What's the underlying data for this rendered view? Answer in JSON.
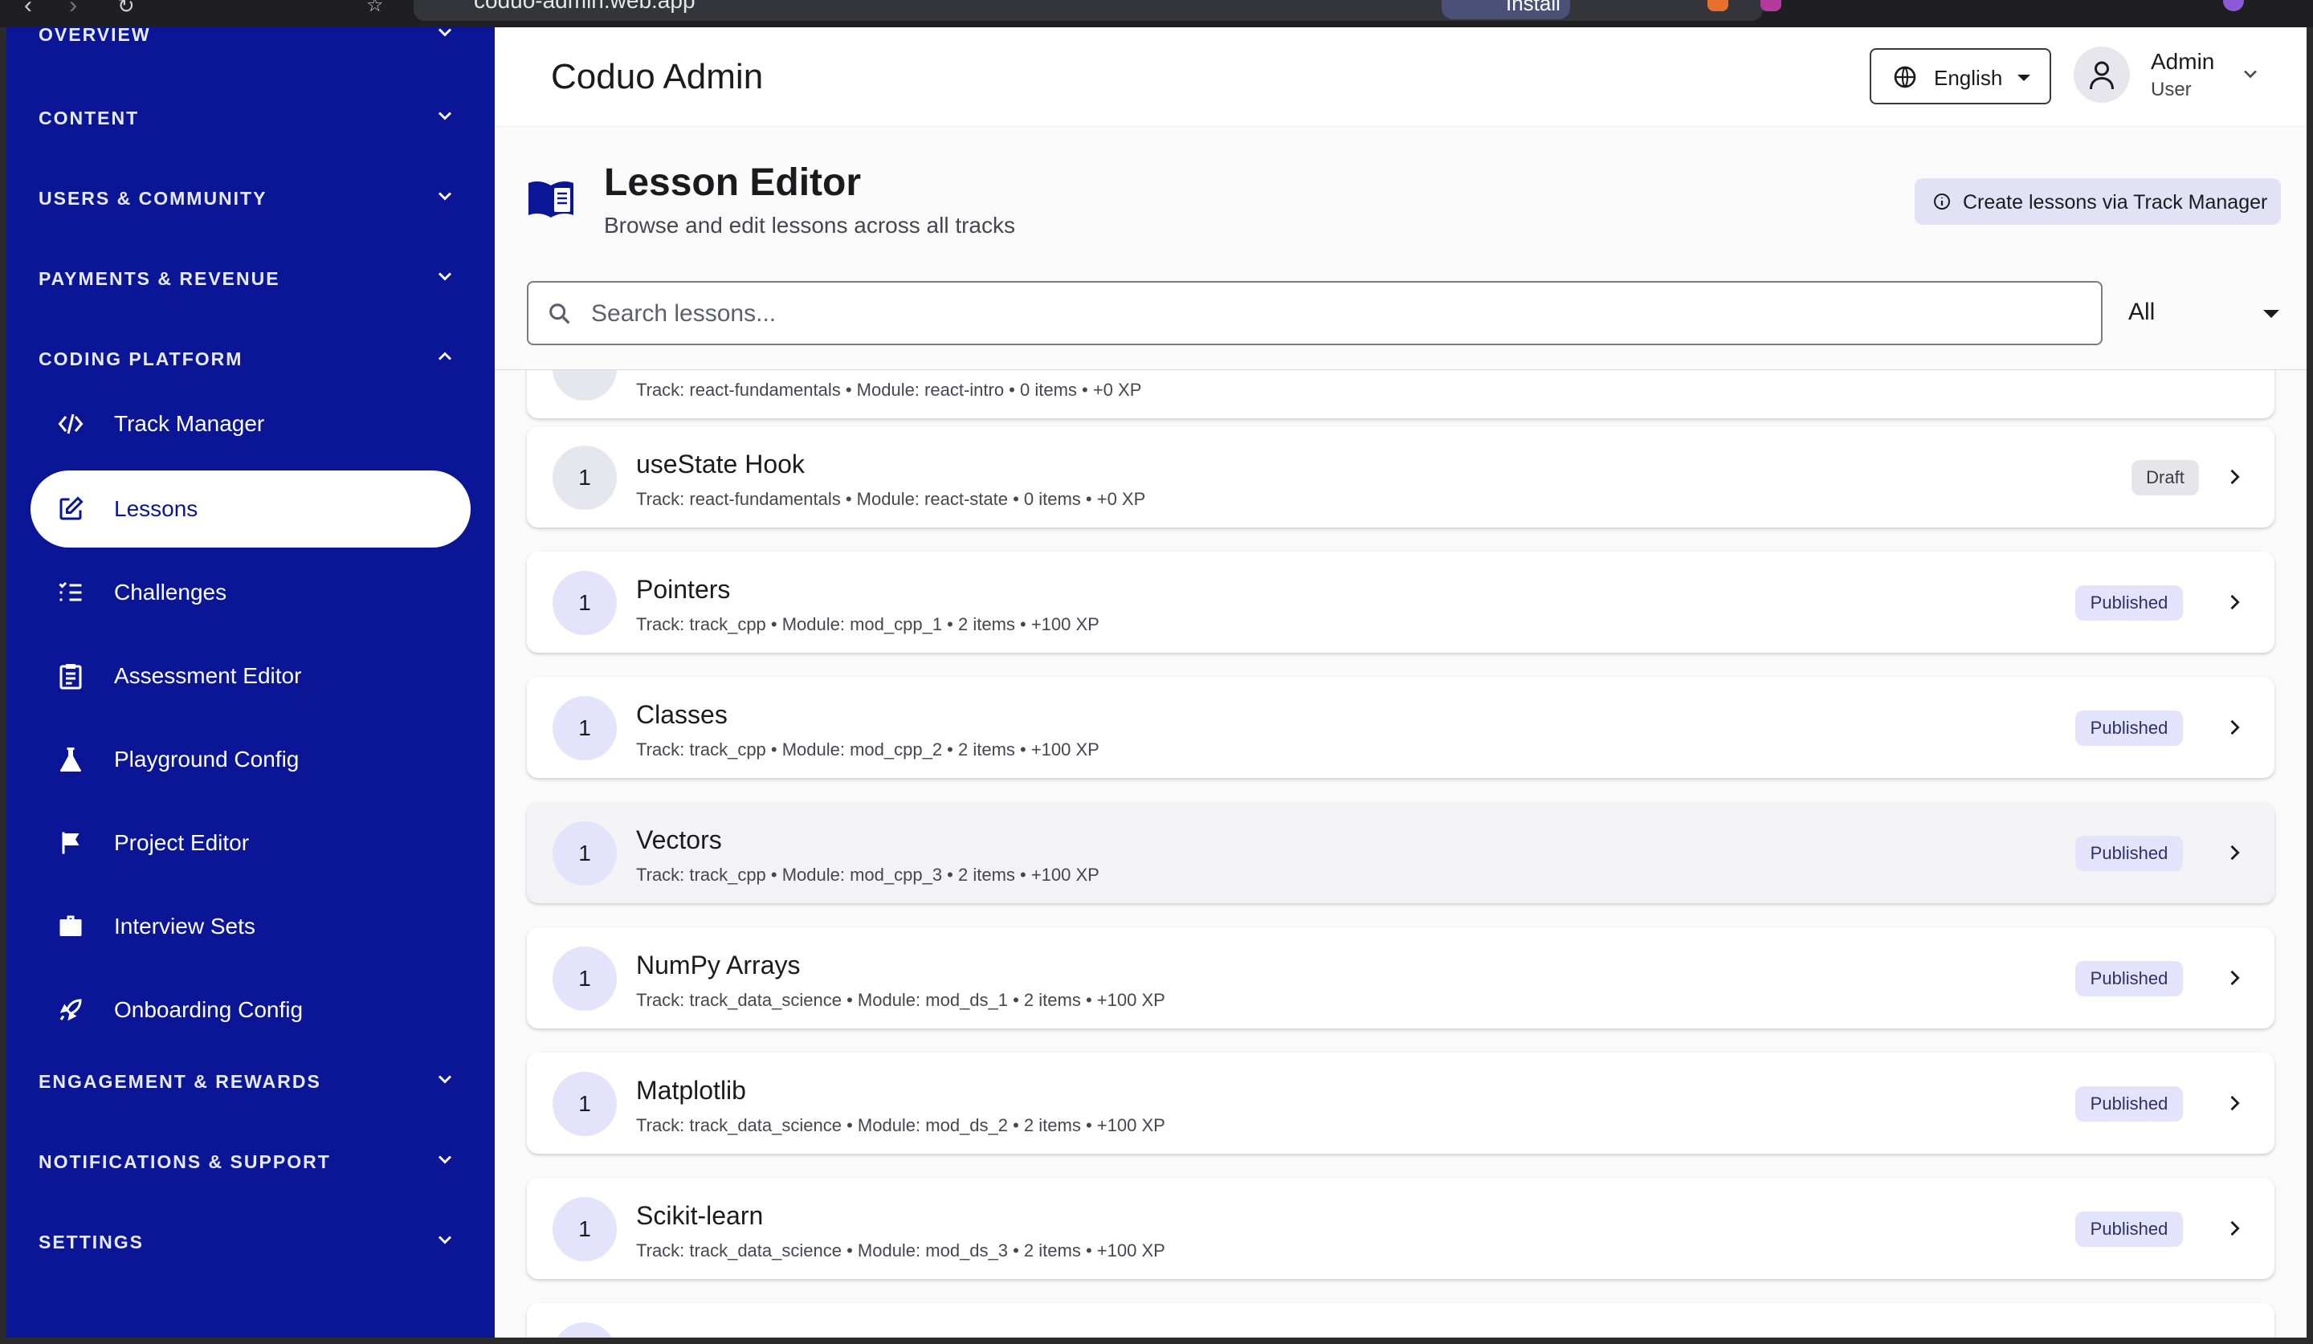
{
  "browser": {
    "url": "coduo-admin.web.app",
    "install_label": "Install"
  },
  "sidebar": {
    "top_section": "OVERVIEW",
    "sections": [
      {
        "label": "CONTENT"
      },
      {
        "label": "USERS & COMMUNITY"
      },
      {
        "label": "PAYMENTS & REVENUE"
      },
      {
        "label": "CODING PLATFORM"
      }
    ],
    "items": [
      {
        "label": "Track Manager",
        "icon": "code-icon"
      },
      {
        "label": "Lessons",
        "icon": "edit-icon",
        "active": true
      },
      {
        "label": "Challenges",
        "icon": "checklist-icon"
      },
      {
        "label": "Assessment Editor",
        "icon": "clipboard-icon"
      },
      {
        "label": "Playground Config",
        "icon": "flask-icon"
      },
      {
        "label": "Project Editor",
        "icon": "flag-icon"
      },
      {
        "label": "Interview Sets",
        "icon": "briefcase-icon"
      },
      {
        "label": "Onboarding Config",
        "icon": "rocket-icon"
      }
    ],
    "bottom_sections": [
      {
        "label": "ENGAGEMENT & REWARDS"
      },
      {
        "label": "NOTIFICATIONS & SUPPORT"
      },
      {
        "label": "SETTINGS"
      }
    ]
  },
  "header": {
    "app_title": "Coduo Admin",
    "language": "English",
    "user_name": "Admin",
    "user_role": "User"
  },
  "page": {
    "title": "Lesson Editor",
    "subtitle": "Browse and edit lessons across all tracks",
    "hint": "Create lessons via Track Manager",
    "search_placeholder": "Search lessons...",
    "filter_value": "All"
  },
  "lessons": [
    {
      "num": "",
      "title": "",
      "meta": "Track: react-fundamentals  •  Module: react-intro  •  0 items  •  +0 XP",
      "status": ""
    },
    {
      "num": "1",
      "title": "useState Hook",
      "meta": "Track: react-fundamentals  •  Module: react-state  •  0 items  •  +0 XP",
      "status": "Draft"
    },
    {
      "num": "1",
      "title": "Pointers",
      "meta": "Track: track_cpp  •  Module: mod_cpp_1  •  2 items  •  +100 XP",
      "status": "Published"
    },
    {
      "num": "1",
      "title": "Classes",
      "meta": "Track: track_cpp  •  Module: mod_cpp_2  •  2 items  •  +100 XP",
      "status": "Published"
    },
    {
      "num": "1",
      "title": "Vectors",
      "meta": "Track: track_cpp  •  Module: mod_cpp_3  •  2 items  •  +100 XP",
      "status": "Published"
    },
    {
      "num": "1",
      "title": "NumPy Arrays",
      "meta": "Track: track_data_science  •  Module: mod_ds_1  •  2 items  •  +100 XP",
      "status": "Published"
    },
    {
      "num": "1",
      "title": "Matplotlib",
      "meta": "Track: track_data_science  •  Module: mod_ds_2  •  2 items  •  +100 XP",
      "status": "Published"
    },
    {
      "num": "1",
      "title": "Scikit-learn",
      "meta": "Track: track_data_science  •  Module: mod_ds_3  •  2 items  •  +100 XP",
      "status": "Published"
    },
    {
      "num": "",
      "title": "",
      "meta": "",
      "status": ""
    }
  ],
  "colors": {
    "sidebar_bg": "#0a1696",
    "accent": "#0a1696",
    "badge_published": "#e3e3fb",
    "badge_draft": "#e6e6ea"
  }
}
